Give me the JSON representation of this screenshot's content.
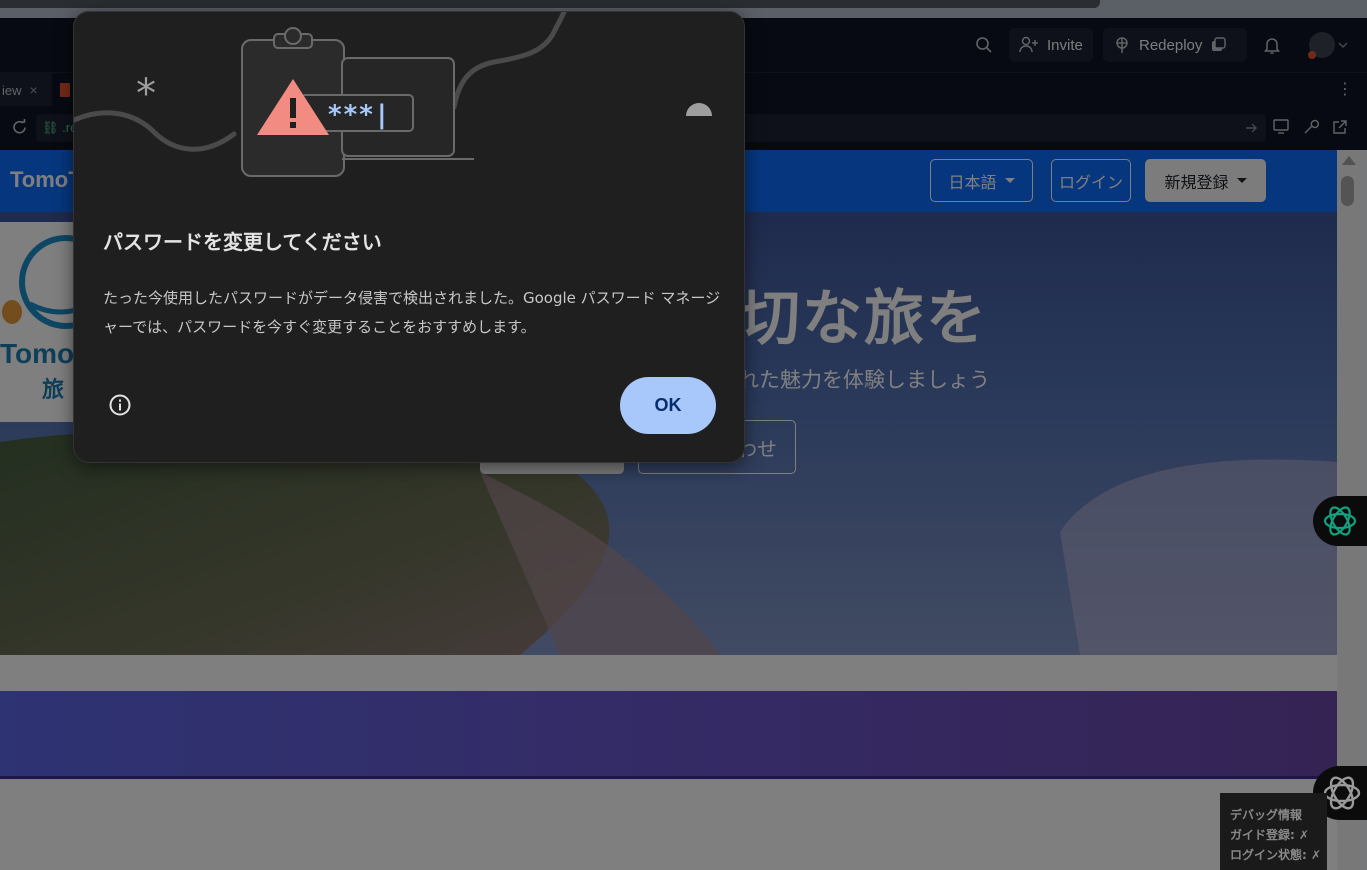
{
  "replit": {
    "invite_label": "Invite",
    "redeploy_label": "Redeploy",
    "tab_label": "iew",
    "url_text": ".re"
  },
  "site": {
    "brand": "TomoT",
    "lang_label": "日本語",
    "login_label": "ログイン",
    "signup_label": "新規登録",
    "hero_title": "切な旅を",
    "hero_subtitle": "れた魅力を体験しましょう",
    "hero_button_outline": "わせ",
    "logo_text_1": "Tomo",
    "logo_text_2": "旅"
  },
  "debug": {
    "title": "デバッグ情報",
    "guide_reg": "ガイド登録: ✗",
    "login_state": "ログイン状態: ✗"
  },
  "dialog": {
    "art_password": "***|",
    "title": "パスワードを変更してください",
    "body": "たった今使用したパスワードがデータ侵害で検出されました。Google パスワード マネージャーでは、パスワードを今すぐ変更することをおすすめします。",
    "ok_label": "OK"
  },
  "colors": {
    "dialog_bg": "#1f1f1f",
    "ok_bg": "#a8c7fa",
    "site_nav": "#0d6efd",
    "warning": "#f28b82"
  }
}
